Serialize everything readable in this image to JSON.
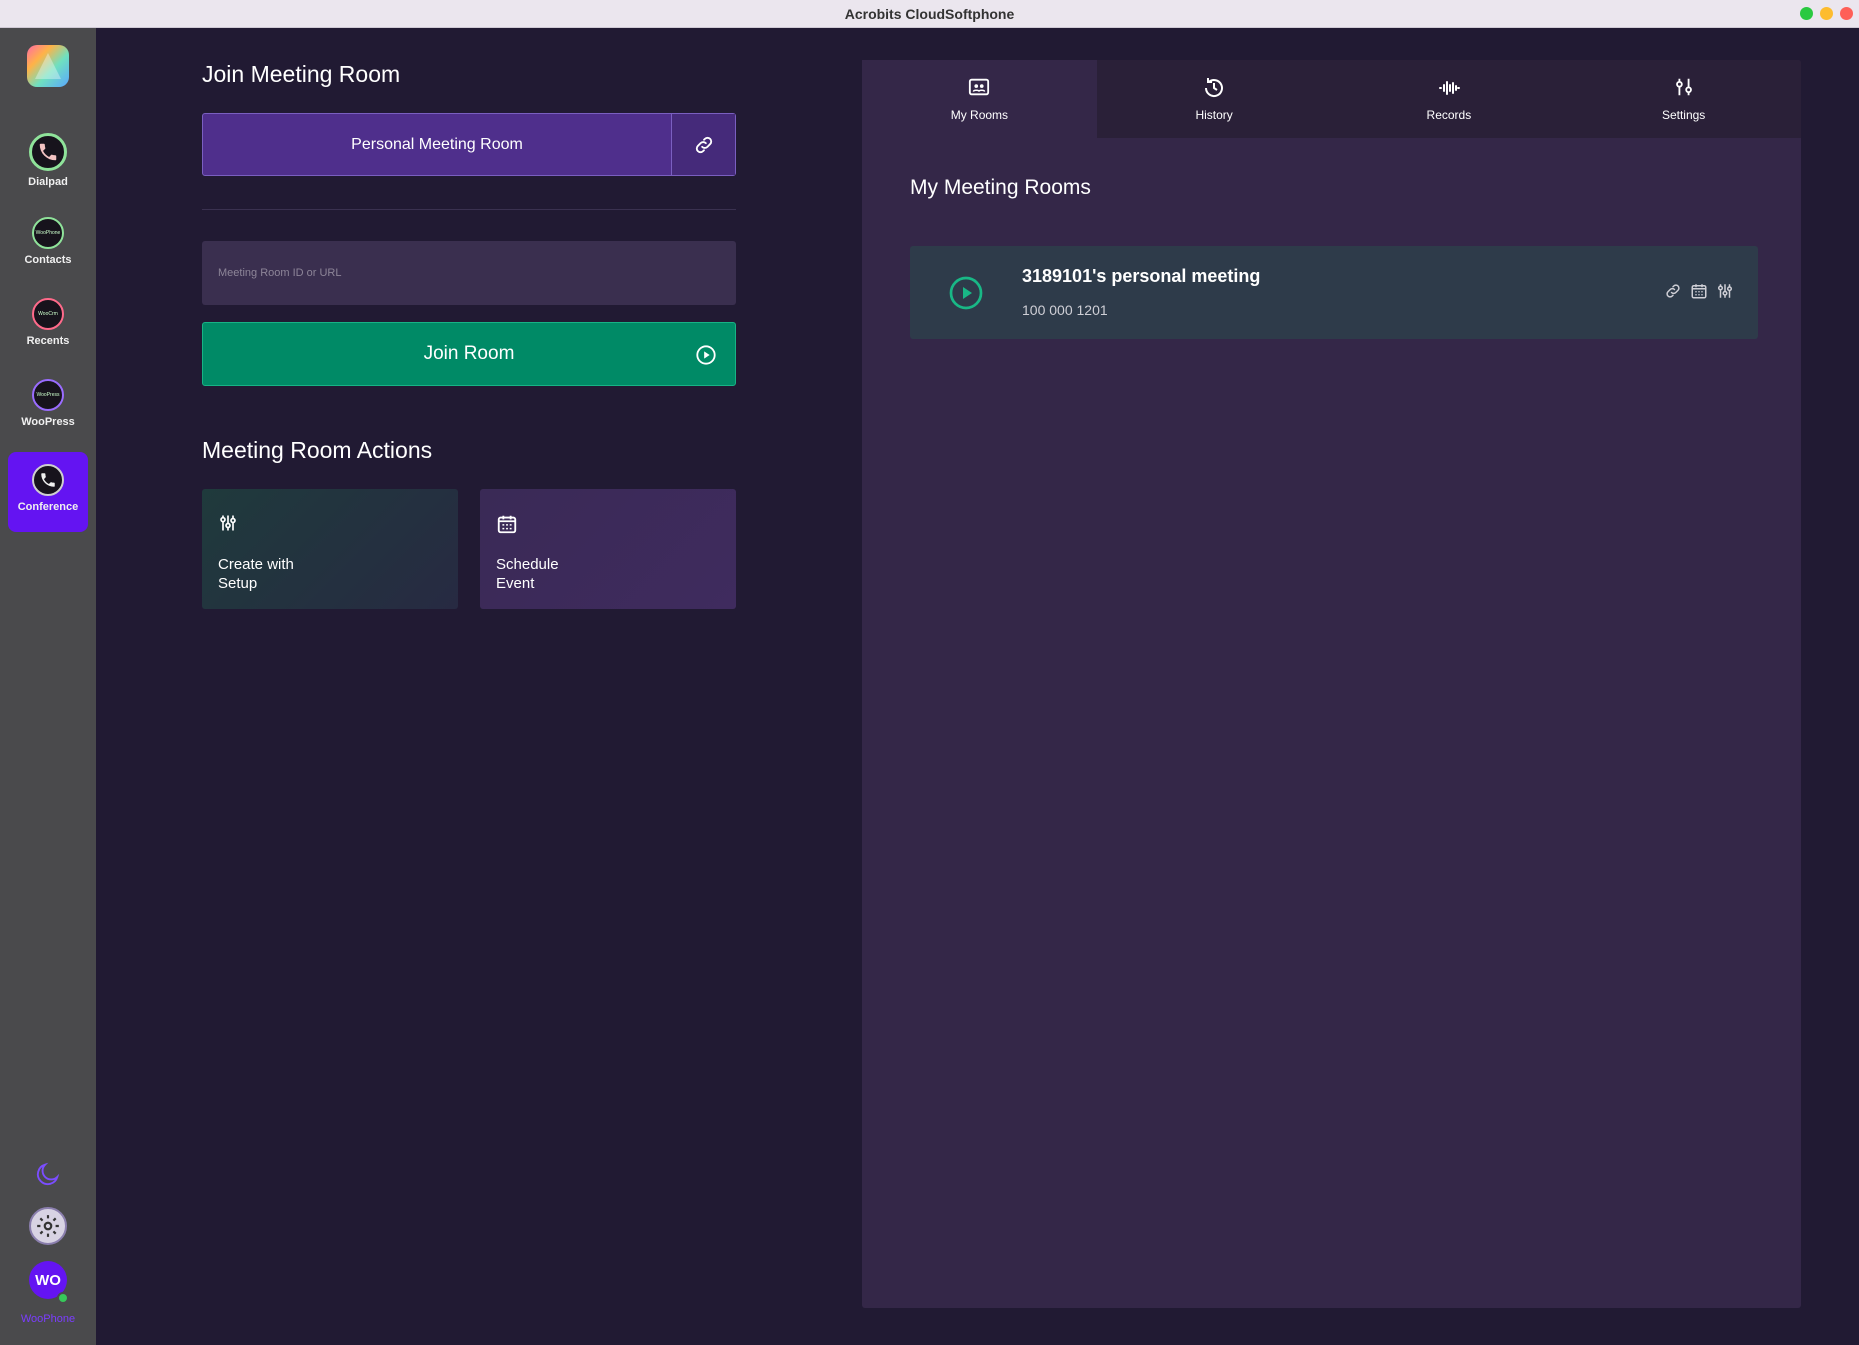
{
  "window": {
    "title": "Acrobits CloudSoftphone",
    "traffic_colors": [
      "#2ac940",
      "#fdbc2e",
      "#fe5f57"
    ]
  },
  "sidebar": {
    "items": [
      {
        "label": "Dialpad",
        "icon": "phone-icon"
      },
      {
        "label": "Contacts",
        "icon": "woophone-icon",
        "badge": "WooPhone"
      },
      {
        "label": "Recents",
        "icon": "woocrm-icon",
        "badge": "WooCrm"
      },
      {
        "label": "WooPress",
        "icon": "woopress-icon",
        "badge": "WooPress"
      },
      {
        "label": "Conference",
        "icon": "phone-icon",
        "active": true
      }
    ],
    "avatar_initials": "WO",
    "avatar_label": "WooPhone",
    "accent": "#6414f2"
  },
  "join": {
    "title": "Join Meeting Room",
    "personal_room_label": "Personal Meeting Room",
    "input_placeholder": "Meeting Room ID or URL",
    "input_value": "",
    "join_label": "Join Room"
  },
  "actions": {
    "title": "Meeting Room Actions",
    "items": [
      {
        "label": "Create with\nSetup",
        "icon": "sliders-icon"
      },
      {
        "label": "Schedule\nEvent",
        "icon": "calendar-icon"
      }
    ]
  },
  "tabs": [
    {
      "label": "My Rooms",
      "icon": "rooms-icon",
      "active": true
    },
    {
      "label": "History",
      "icon": "history-icon"
    },
    {
      "label": "Records",
      "icon": "waveform-icon"
    },
    {
      "label": "Settings",
      "icon": "sliders-icon"
    }
  ],
  "rooms": {
    "title": "My Meeting Rooms",
    "list": [
      {
        "name": "3189101's personal meeting",
        "number": "100 000 1201"
      }
    ]
  }
}
